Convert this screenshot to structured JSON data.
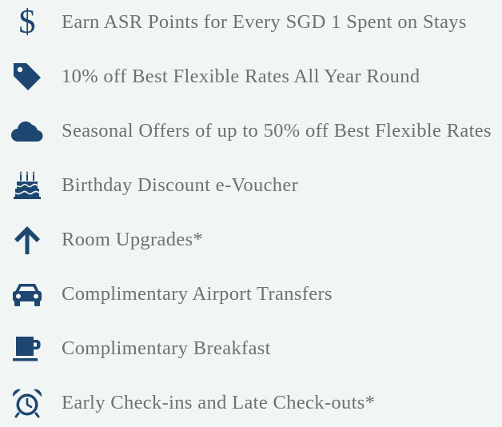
{
  "colors": {
    "icon": "#1d4670",
    "text": "#6e716f",
    "background": "#f1f5f3"
  },
  "benefits": [
    {
      "icon": "dollar-icon",
      "label": "Earn ASR Points for Every SGD 1 Spent on Stays"
    },
    {
      "icon": "tag-icon",
      "label": "10% off Best Flexible Rates All Year Round"
    },
    {
      "icon": "cloud-icon",
      "label": "Seasonal Offers of up to 50% off Best Flexible Rates"
    },
    {
      "icon": "birthday-cake-icon",
      "label": "Birthday Discount e-Voucher"
    },
    {
      "icon": "arrow-up-icon",
      "label": "Room Upgrades*"
    },
    {
      "icon": "car-icon",
      "label": "Complimentary Airport Transfers"
    },
    {
      "icon": "coffee-mug-icon",
      "label": "Complimentary Breakfast"
    },
    {
      "icon": "alarm-clock-icon",
      "label": "Early Check-ins and Late Check-outs*"
    }
  ]
}
